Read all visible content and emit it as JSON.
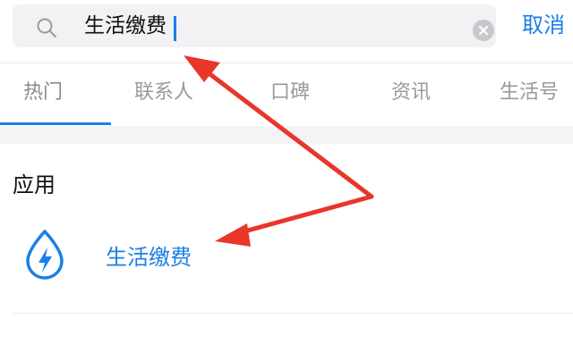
{
  "search": {
    "query": "生活缴费",
    "cancel_label": "取消"
  },
  "tabs": [
    {
      "label": "热门"
    },
    {
      "label": "联系人"
    },
    {
      "label": "口碑"
    },
    {
      "label": "资讯"
    },
    {
      "label": "生活号"
    }
  ],
  "results": {
    "section_title": "应用",
    "apps": [
      {
        "label": "生活缴费",
        "icon": "bolt-drop-icon"
      }
    ]
  },
  "colors": {
    "accent": "#1a7fe6",
    "annotation_arrow": "#e8362b"
  }
}
